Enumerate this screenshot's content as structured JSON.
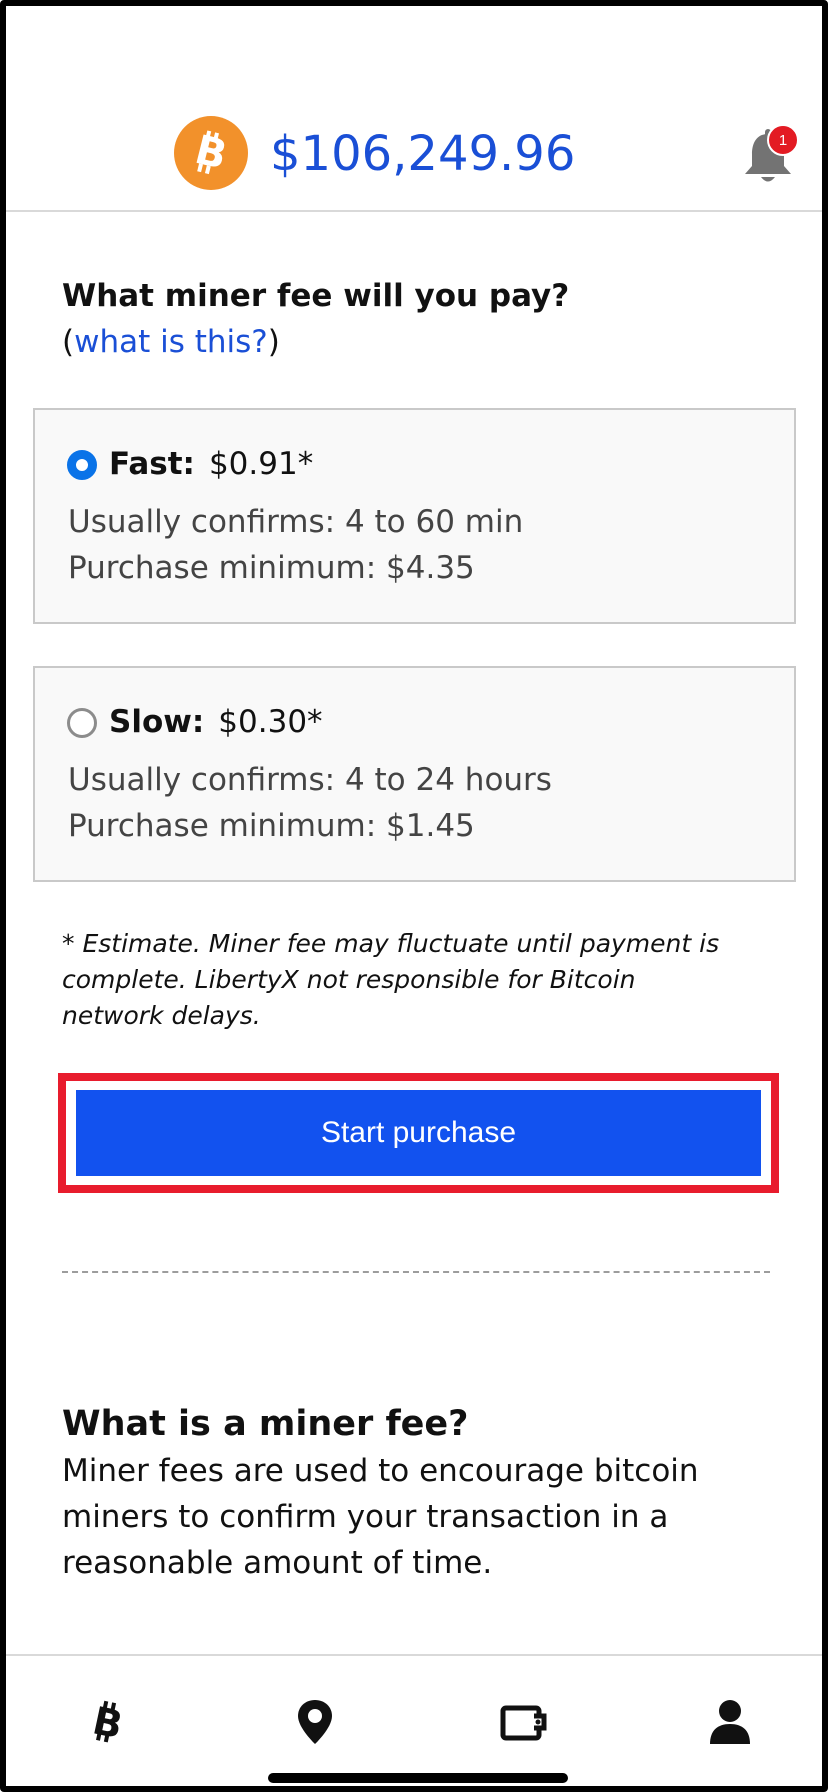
{
  "header": {
    "coin_symbol": "₿",
    "price": "$106,249.96",
    "notification_count": "1",
    "accent_color": "#1a4fd6",
    "coin_color": "#f2912b"
  },
  "question": {
    "title": "What miner fee will you pay?",
    "open_paren": "(",
    "link_text": "what is this?",
    "close_paren": ")"
  },
  "options": [
    {
      "name": "Fast:",
      "fee": "$0.91*",
      "confirms": "Usually confirms: 4 to 60 min",
      "minimum": "Purchase minimum: $4.35",
      "selected": true
    },
    {
      "name": "Slow:",
      "fee": "$0.30*",
      "confirms": "Usually confirms: 4 to 24 hours",
      "minimum": "Purchase minimum: $1.45",
      "selected": false
    }
  ],
  "disclaimer": "* Estimate. Miner fee may fluctuate until payment is complete. LibertyX not responsible for Bitcoin network delays.",
  "button": {
    "label": "Start purchase",
    "color": "#1252ef",
    "highlight_color": "#e81c2d"
  },
  "info": {
    "title": "What is a miner fee?",
    "body": "Miner fees are used to encourage bitcoin miners to confirm your transaction in a reasonable amount of time."
  },
  "tabbar": {
    "items": [
      "bitcoin-icon",
      "location-pin-icon",
      "wallet-icon",
      "profile-icon"
    ]
  }
}
